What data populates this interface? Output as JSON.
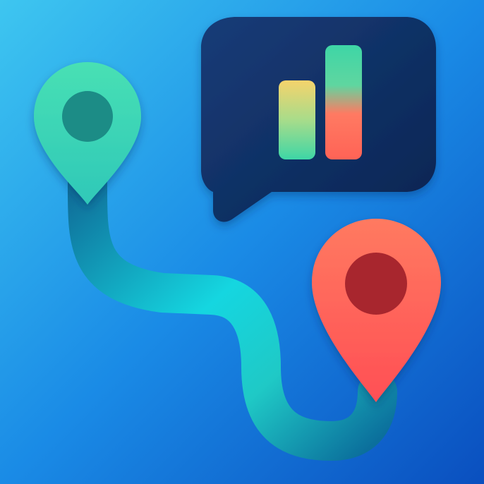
{
  "icon": {
    "subject": "route-analytics-app-icon",
    "colors": {
      "background_top_left": "#3ec6f0",
      "background_bottom_right": "#0a4fbf",
      "route_start": "#0f86a8",
      "route_mid": "#15d6e0",
      "route_end": "#0b6f9c",
      "start_pin": "#3fdcb0",
      "start_pin_dot": "#1a8c86",
      "end_pin": "#ff6b5a",
      "end_pin_dot": "#a8262e",
      "bubble": "#0e2f66",
      "bar_short_top": "#f5d36c",
      "bar_short_bottom": "#3ed6a6",
      "bar_tall_top": "#3ed6a6",
      "bar_tall_bottom": "#ff6b5a"
    },
    "elements": [
      {
        "name": "start-location-pin-icon"
      },
      {
        "name": "end-location-pin-icon"
      },
      {
        "name": "route-path"
      },
      {
        "name": "chat-bubble-icon"
      },
      {
        "name": "bar-chart-icon"
      }
    ]
  }
}
